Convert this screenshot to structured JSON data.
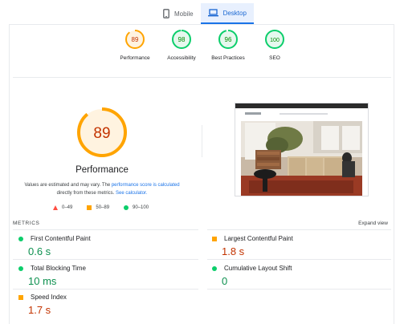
{
  "tabs": [
    {
      "label": "Mobile",
      "icon": "phone-icon",
      "active": false
    },
    {
      "label": "Desktop",
      "icon": "laptop-icon",
      "active": true
    }
  ],
  "scores": [
    {
      "value": "89",
      "label": "Performance",
      "score": 89,
      "color": "#ffa400",
      "text_color": "#c33300",
      "fill": "#fff3e0"
    },
    {
      "value": "98",
      "label": "Accessibility",
      "score": 98,
      "color": "#0cce6b",
      "text_color": "#008800",
      "fill": "#e6f8ee"
    },
    {
      "value": "96",
      "label": "Best Practices",
      "score": 96,
      "color": "#0cce6b",
      "text_color": "#008800",
      "fill": "#e6f8ee"
    },
    {
      "value": "100",
      "label": "SEO",
      "score": 100,
      "color": "#0cce6b",
      "text_color": "#008800",
      "fill": "#e6f8ee"
    }
  ],
  "performance": {
    "score": "89",
    "score_fraction": 0.89,
    "title": "Performance",
    "note_prefix": "Values are estimated and may vary. The ",
    "note_link1": "performance score is calculated",
    "note_middle": " directly from these metrics. ",
    "note_link2": "See calculator."
  },
  "legend": [
    {
      "shape": "triangle",
      "range": "0–49",
      "color": "#ff4e42"
    },
    {
      "shape": "square",
      "range": "50–89",
      "color": "#ffa400"
    },
    {
      "shape": "circle",
      "range": "90–100",
      "color": "#0cce6b"
    }
  ],
  "metrics": {
    "header": "METRICS",
    "expand_label": "Expand view",
    "items": [
      {
        "name": "First Contentful Paint",
        "value": "0.6 s",
        "status": "good"
      },
      {
        "name": "Largest Contentful Paint",
        "value": "1.8 s",
        "status": "average"
      },
      {
        "name": "Total Blocking Time",
        "value": "10 ms",
        "status": "good"
      },
      {
        "name": "Cumulative Layout Shift",
        "value": "0",
        "status": "good"
      },
      {
        "name": "Speed Index",
        "value": "1.7 s",
        "status": "average"
      }
    ]
  }
}
